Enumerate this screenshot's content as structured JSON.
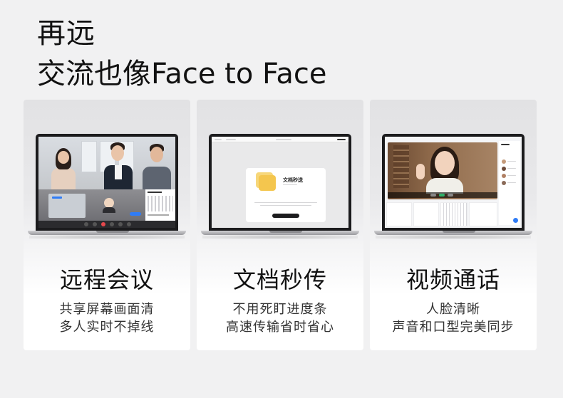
{
  "headline": {
    "line1": "再远",
    "line2": "交流也像Face to Face"
  },
  "cards": [
    {
      "title": "远程会议",
      "sub1": "共享屏幕画面清",
      "sub2": "多人实时不掉线"
    },
    {
      "title": "文档秒传",
      "sub1": "不用死盯进度条",
      "sub2": "高速传输省时省心"
    },
    {
      "title": "视频通话",
      "sub1": "人脸清晰",
      "sub2": "声音和口型完美同步"
    }
  ],
  "screen2": {
    "dialog_title": "文档秒送"
  },
  "colors": {
    "accent_blue": "#2f7cf6",
    "green_button": "#2fb36a",
    "red_button": "#e5484d",
    "folder_yellow": "#f4c64e"
  }
}
